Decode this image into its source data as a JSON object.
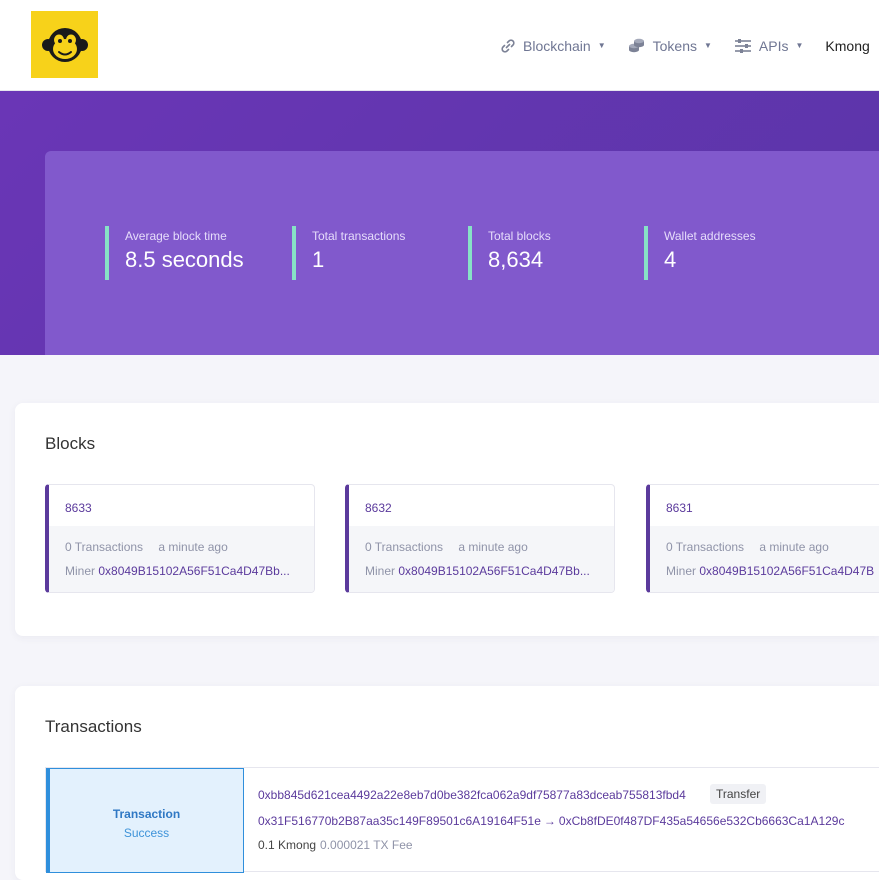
{
  "header": {
    "nav": [
      {
        "label": "Blockchain",
        "icon": "link-icon"
      },
      {
        "label": "Tokens",
        "icon": "coins-icon"
      },
      {
        "label": "APIs",
        "icon": "sliders-icon"
      },
      {
        "label": "Kmong"
      }
    ]
  },
  "stats": [
    {
      "label": "Average block time",
      "value": "8.5 seconds"
    },
    {
      "label": "Total transactions",
      "value": "1"
    },
    {
      "label": "Total blocks",
      "value": "8,634"
    },
    {
      "label": "Wallet addresses",
      "value": "4"
    }
  ],
  "blocks": {
    "title": "Blocks",
    "items": [
      {
        "number": "8633",
        "transactions": "0 Transactions",
        "time": "a minute ago",
        "miner_label": "Miner",
        "miner": "0x8049B15102A56F51Ca4D47Bb..."
      },
      {
        "number": "8632",
        "transactions": "0 Transactions",
        "time": "a minute ago",
        "miner_label": "Miner",
        "miner": "0x8049B15102A56F51Ca4D47Bb..."
      },
      {
        "number": "8631",
        "transactions": "0 Transactions",
        "time": "a minute ago",
        "miner_label": "Miner",
        "miner": "0x8049B15102A56F51Ca4D47B"
      }
    ]
  },
  "transactions": {
    "title": "Transactions",
    "items": [
      {
        "type": "Transaction",
        "status": "Success",
        "hash": "0xbb845d621cea4492a22e8eb7d0be382fca062a9df75877a83dceab755813fbd4",
        "badge": "Transfer",
        "from": "0x31F516770b2B87aa35c149F89501c6A19164F51e",
        "arrow": "→",
        "to": "0xCb8fDE0f487DF435a54656e532Cb6663Ca1A129c",
        "value": "0.1 Kmong",
        "fee": "0.000021 TX Fee"
      }
    ]
  },
  "colors": {
    "brand_yellow": "#f7d21a",
    "hero_purple": "#6a36b6",
    "card_purple": "#8159cc",
    "accent_mint": "#87e2c6",
    "link_purple": "#5b3a9c",
    "tx_blue": "#2f8fdc"
  }
}
